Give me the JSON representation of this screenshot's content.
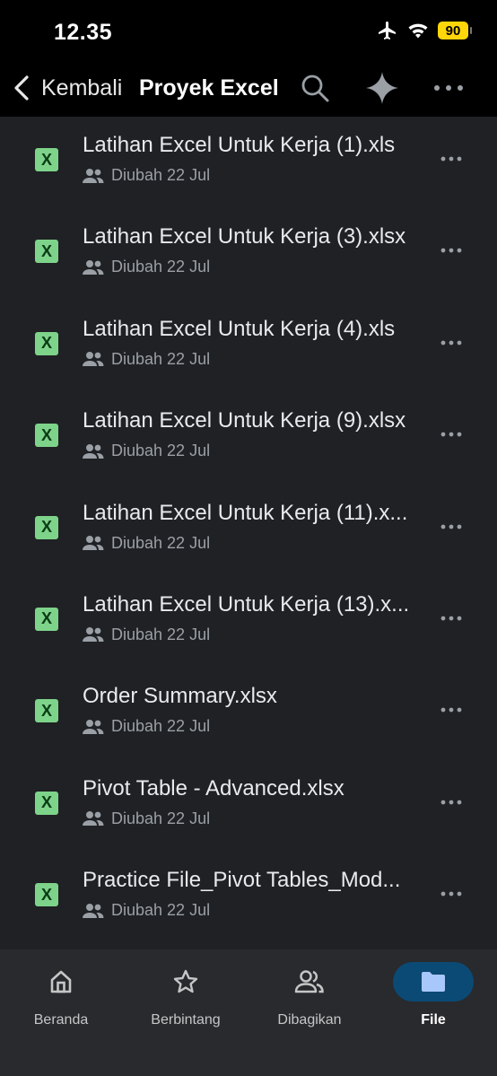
{
  "status": {
    "time": "12.35",
    "battery": "90"
  },
  "header": {
    "back_label": "Kembali",
    "title": "Proyek Excel"
  },
  "file_icon_letter": "X",
  "files": [
    {
      "name": "Latihan Excel Untuk Kerja (1).xls",
      "meta": "Diubah 22 Jul"
    },
    {
      "name": "Latihan Excel Untuk Kerja (3).xlsx",
      "meta": "Diubah 22 Jul"
    },
    {
      "name": "Latihan Excel Untuk Kerja (4).xls",
      "meta": "Diubah 22 Jul"
    },
    {
      "name": "Latihan Excel Untuk Kerja (9).xlsx",
      "meta": "Diubah 22 Jul"
    },
    {
      "name": "Latihan Excel Untuk Kerja (11).x...",
      "meta": "Diubah 22 Jul"
    },
    {
      "name": "Latihan Excel Untuk Kerja (13).x...",
      "meta": "Diubah 22 Jul"
    },
    {
      "name": "Order Summary.xlsx",
      "meta": "Diubah 22 Jul"
    },
    {
      "name": "Pivot Table - Advanced.xlsx",
      "meta": "Diubah 22 Jul"
    },
    {
      "name": "Practice File_Pivot Tables_Mod...",
      "meta": "Diubah 22 Jul"
    }
  ],
  "nav": {
    "home": "Beranda",
    "starred": "Berbintang",
    "shared": "Dibagikan",
    "files": "File"
  },
  "colors": {
    "background": "#1f2124",
    "excel_icon": "#7ed38a",
    "active_nav": "#0b4a75",
    "battery": "#ffd60a"
  }
}
